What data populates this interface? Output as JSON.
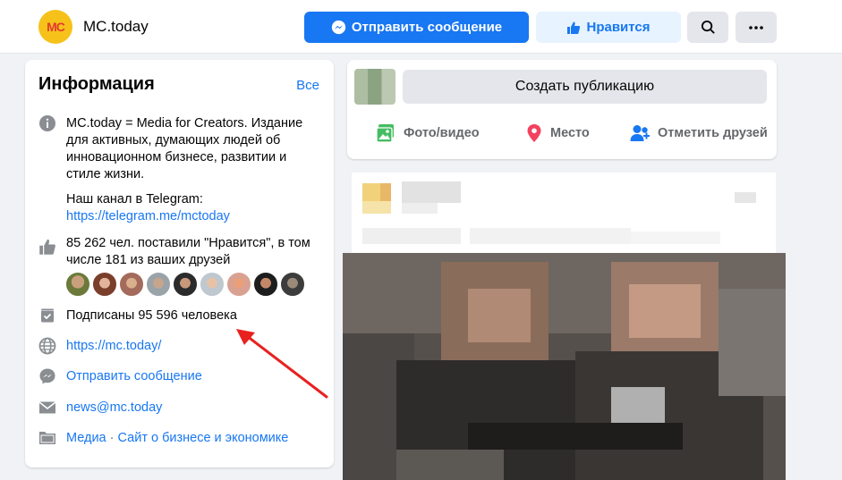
{
  "header": {
    "page_name": "MC.today",
    "logo_text": "МС",
    "send_message_label": "Отправить сообщение",
    "like_label": "Нравится",
    "search_icon": "search-icon",
    "more_icon": "more-icon"
  },
  "info": {
    "title": "Информация",
    "see_all": "Все",
    "description": "MC.today = Media for Creators. Издание для активных, думающих людей об инновационном бизнесе, развитии и стиле жизни.",
    "telegram_label": "Наш канал в Telegram:",
    "telegram_link": "https://telegram.me/mctoday",
    "likes_text": "85 262 чел. поставили \"Нравится\", в том числе 181 из ваших друзей",
    "followers_text": "Подписаны 95 596 человека",
    "website": "https://mc.today/",
    "send_message": "Отправить сообщение",
    "email": "news@mc.today",
    "category_1": "Медиа",
    "category_sep": " · ",
    "category_2": "Сайт о бизнесе и экономике"
  },
  "composer": {
    "create_post": "Создать публикацию",
    "photo_video": "Фото/видео",
    "place": "Место",
    "tag_friends": "Отметить друзей"
  },
  "colors": {
    "primary": "#1877f2",
    "like_bg": "#e7f3ff",
    "annotation": "#e8211f",
    "logo_bg": "#f6c21a"
  }
}
